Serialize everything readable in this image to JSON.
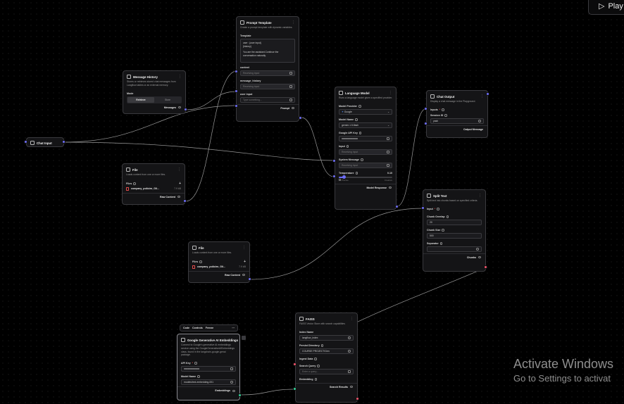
{
  "playground": {
    "label": "Play"
  },
  "watermark": {
    "line1": "Activate Windows",
    "line2": "Go to Settings to activat"
  },
  "toolbar": {
    "code": "Code",
    "controls": "Controls",
    "freeze": "Freeze"
  },
  "nodes": {
    "chat_input": {
      "title": "Chat Input"
    },
    "prompt": {
      "title": "Prompt Template",
      "desc": "Create a prompt template with dynamic variables.",
      "template_label": "Template",
      "template_line1": "user : {user input}",
      "template_line2": "{history}",
      "template_line3": "You are the assistant.Continue the",
      "template_line4": "conversation naturally.",
      "context_label": "context",
      "context_placeholder": "Receiving input",
      "history_label": "message_history",
      "history_placeholder": "Receiving input",
      "user_label": "user input",
      "user_placeholder": "Type something...",
      "output": "Prompt"
    },
    "message_history": {
      "title": "Message History",
      "desc": "Stores or retrieves stored chat messages from Langflow tables or an external memory.",
      "mode_label": "Mode",
      "mode_options": [
        "Retrieve",
        "Store"
      ],
      "output": "Messages"
    },
    "file1": {
      "title": "File",
      "desc": "Loads content from one or more files.",
      "files_label": "Files",
      "file_name": "company_policies_Gli...",
      "file_size": "7.9 kB",
      "output": "Raw Content"
    },
    "file2": {
      "title": "File",
      "desc": "Loads content from one or more files.",
      "files_label": "Files",
      "file_name": "company_policies_Gli...",
      "file_size": "7.9 kB",
      "output": "Raw Content"
    },
    "language_model": {
      "title": "Language Model",
      "desc": "Runs a language model given a specified provider.",
      "provider_label": "Model Provider",
      "provider_value": "Google",
      "model_label": "Model Name",
      "model_value": "gemini-1.5-flash",
      "api_label": "Google API Key",
      "api_value": "••••••••••••••••••••••••••••••••••",
      "input_label": "Input",
      "input_placeholder": "Receiving input",
      "system_label": "System Message",
      "system_placeholder": "Receiving input",
      "temp_label": "Temperature",
      "temp_value": "0.10",
      "temp_fraction": 0.1,
      "min_label": "Precise",
      "max_label": "Creative",
      "output": "Model Response"
    },
    "chat_output": {
      "title": "Chat Output",
      "desc": "Display a chat message in the Playground.",
      "inputs_label": "Inputs",
      "session_label": "Session ID",
      "session_value": "yash",
      "output": "Output Message"
    },
    "split_text": {
      "title": "Split Text",
      "desc": "Split text into chunks based on specified criteria.",
      "input_label": "Input",
      "overlap_label": "Chunk Overlap",
      "overlap_value": "20",
      "size_label": "Chunk Size",
      "size_value": "500",
      "separator_label": "Separator",
      "output": "Chunks"
    },
    "embeddings": {
      "title": "Google Generative AI Embeddings",
      "desc": "Connect to Google's generative AI embeddings service using the GoogleGenerativeAIEmbeddings class, found in the langchain-google-genai package.",
      "api_label": "API Key",
      "api_value": "••••••••••••••••••••••••••••••••",
      "model_label": "Model Name",
      "model_value": "models/text-embedding-001",
      "output": "Embeddings"
    },
    "faiss": {
      "title": "FAISS",
      "desc": "FAISS Vector Store with search capabilities",
      "index_label": "Index Name",
      "index_value": "langflow_index",
      "dir_label": "Persist Directory",
      "dir_value": "COURSE PROJECT\\Gen",
      "ingest_label": "Ingest Data",
      "query_label": "Search Query",
      "query_placeholder": "Enter a query...",
      "emb_label": "Embedding",
      "output": "Search Results"
    }
  }
}
